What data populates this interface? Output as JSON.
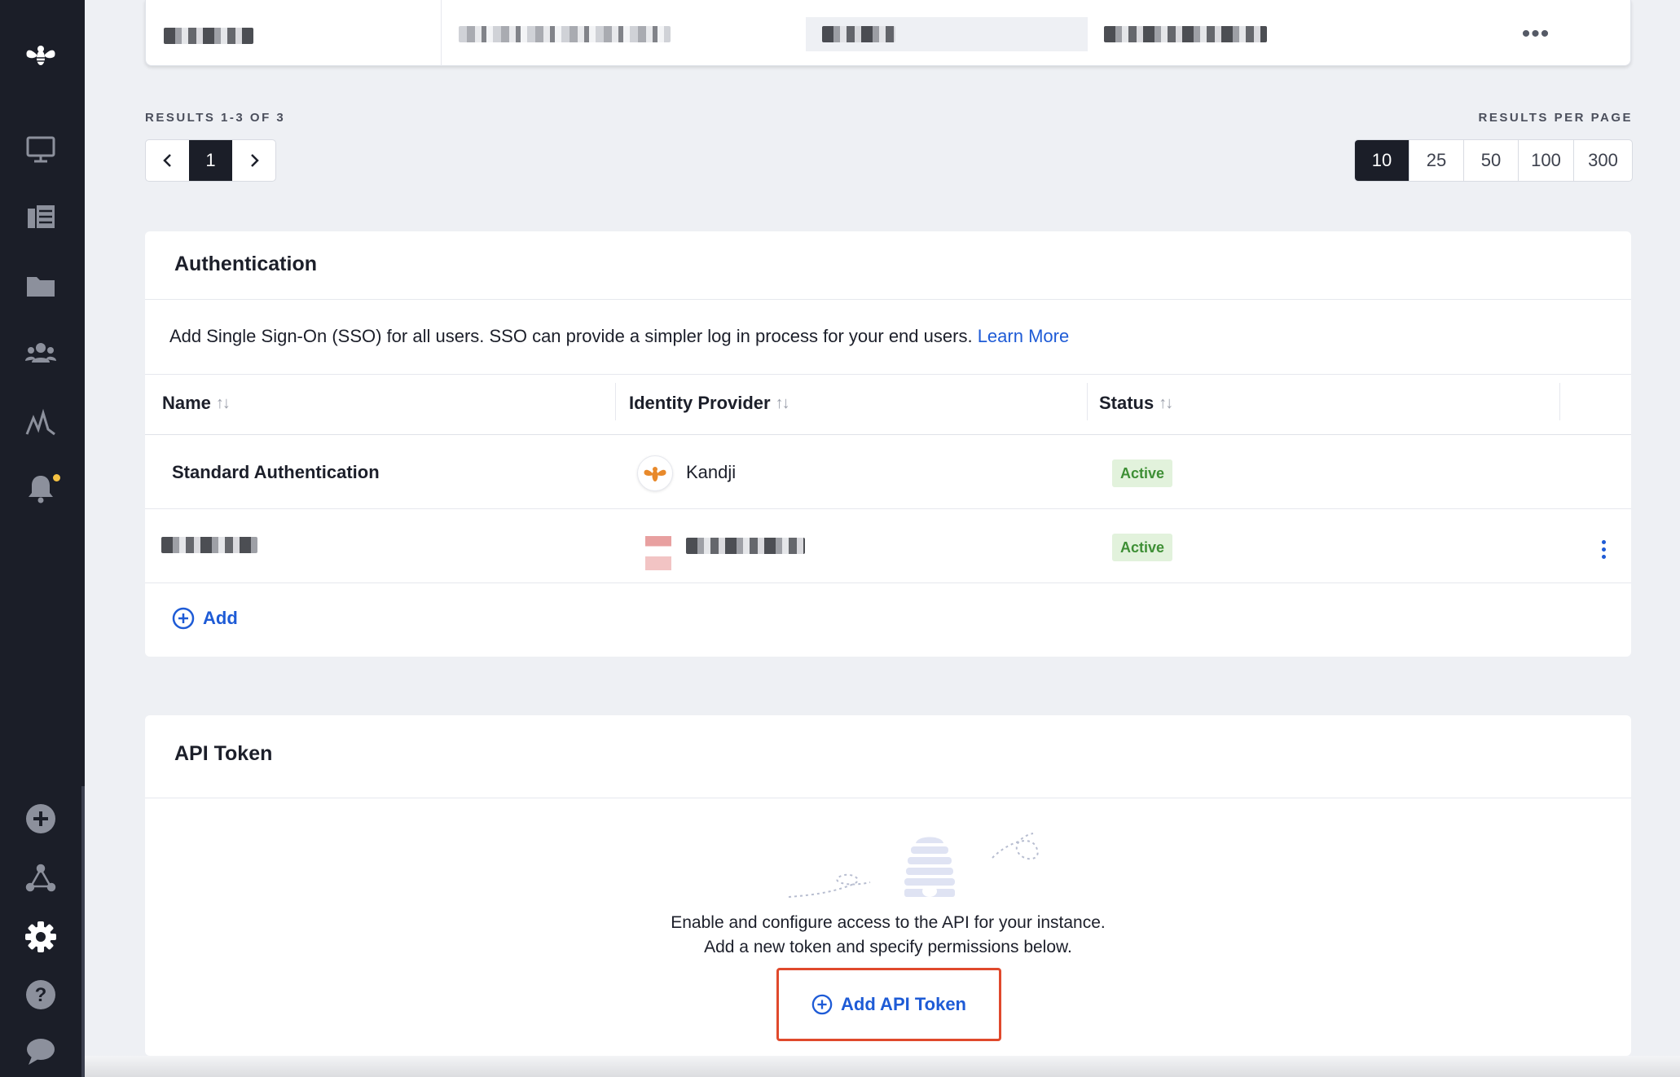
{
  "sidebar": {
    "items": [
      {
        "icon": "bee-logo-icon"
      },
      {
        "icon": "computer-icon"
      },
      {
        "icon": "library-icon"
      },
      {
        "icon": "folder-icon"
      },
      {
        "icon": "users-icon"
      },
      {
        "icon": "activity-icon"
      },
      {
        "icon": "bell-icon"
      },
      {
        "icon": "add-icon"
      },
      {
        "icon": "integrations-icon"
      },
      {
        "icon": "settings-icon"
      },
      {
        "icon": "help-icon"
      },
      {
        "icon": "chat-icon"
      }
    ]
  },
  "pagination": {
    "results_label": "RESULTS 1-3 OF 3",
    "current_page": "1",
    "per_page_label": "RESULTS PER PAGE",
    "per_page_options": [
      "10",
      "25",
      "50",
      "100",
      "300"
    ],
    "per_page_selected": "10"
  },
  "authentication": {
    "title": "Authentication",
    "description": "Add Single Sign-On (SSO) for all users. SSO can provide a simpler log in process for your end users.",
    "learn_more": "Learn More",
    "columns": {
      "name": "Name",
      "identity_provider": "Identity Provider",
      "status": "Status",
      "sort_glyph": "↑↓"
    },
    "rows": [
      {
        "name": "Standard Authentication",
        "provider": "Kandji",
        "status": "Active"
      },
      {
        "name": "",
        "provider": "",
        "status": "Active"
      }
    ],
    "add_label": "Add"
  },
  "api_token": {
    "title": "API Token",
    "line1": "Enable and configure access to the API for your instance.",
    "line2": "Add a new token and specify permissions below.",
    "button_label": "Add API Token"
  },
  "colors": {
    "sidebar_bg": "#1b1e28",
    "link_blue": "#1e5bd6",
    "active_green": "#3e8f35",
    "highlight_red": "#e0492c"
  }
}
